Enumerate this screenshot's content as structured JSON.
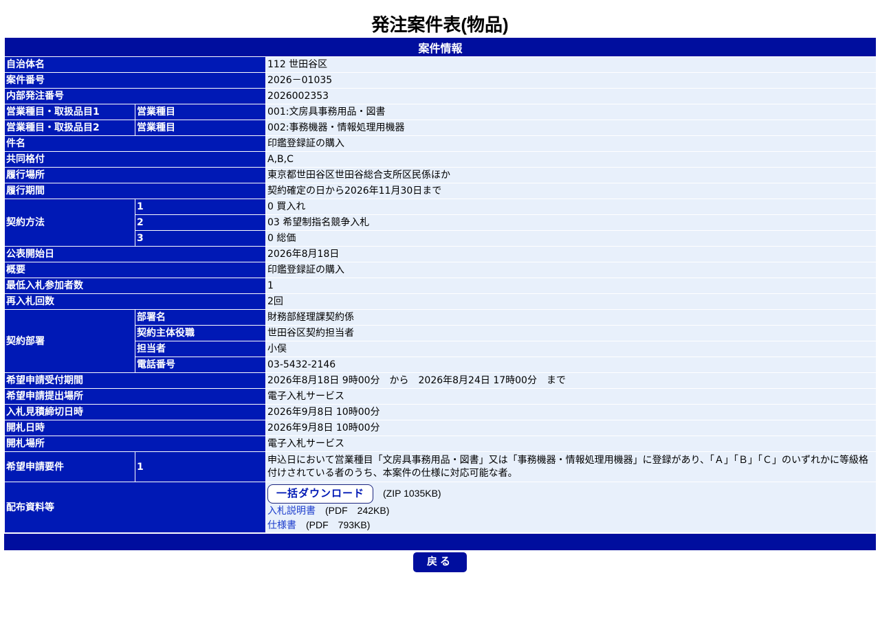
{
  "title": "発注案件表(物品)",
  "section_header": "案件情報",
  "rows": {
    "municipality": {
      "label": "自治体名",
      "value": "112 世田谷区"
    },
    "case_number": {
      "label": "案件番号",
      "value": "2026－01035"
    },
    "internal_number": {
      "label": "内部発注番号",
      "value": "2026002353"
    },
    "business_type1": {
      "label": "営業種目・取扱品目1",
      "sub": "営業種目",
      "value": "001:文房具事務用品・図書"
    },
    "business_type2": {
      "label": "営業種目・取扱品目2",
      "sub": "営業種目",
      "value": "002:事務機器・情報処理用機器"
    },
    "subject": {
      "label": "件名",
      "value": "印鑑登録証の購入"
    },
    "joint_rating": {
      "label": "共同格付",
      "value": "A,B,C"
    },
    "place": {
      "label": "履行場所",
      "value": "東京都世田谷区世田谷総合支所区民係ほか"
    },
    "period": {
      "label": "履行期間",
      "value": "契約確定の日から2026年11月30日まで"
    },
    "contract_method": {
      "label": "契約方法",
      "items": [
        {
          "sub": "1",
          "value": "0 買入れ"
        },
        {
          "sub": "2",
          "value": "03 希望制指名競争入札"
        },
        {
          "sub": "3",
          "value": "0 総価"
        }
      ]
    },
    "publish_date": {
      "label": "公表開始日",
      "value": "2026年8月18日"
    },
    "overview": {
      "label": "概要",
      "value": "印鑑登録証の購入"
    },
    "min_bidders": {
      "label": "最低入札参加者数",
      "value": "1"
    },
    "rebid_count": {
      "label": "再入札回数",
      "value": "2回"
    },
    "department": {
      "label": "契約部署",
      "items": [
        {
          "sub": "部署名",
          "value": "財務部経理課契約係"
        },
        {
          "sub": "契約主体役職",
          "value": "世田谷区契約担当者"
        },
        {
          "sub": "担当者",
          "value": "小俣"
        },
        {
          "sub": "電話番号",
          "value": "03-5432-2146"
        }
      ]
    },
    "application_period": {
      "label": "希望申請受付期間",
      "value": "2026年8月18日 9時00分　から　2026年8月24日 17時00分　まで"
    },
    "application_place": {
      "label": "希望申請提出場所",
      "value": "電子入札サービス"
    },
    "estimate_deadline": {
      "label": "入札見積締切日時",
      "value": "2026年9月8日 10時00分"
    },
    "opening_datetime": {
      "label": "開札日時",
      "value": "2026年9月8日 10時00分"
    },
    "opening_place": {
      "label": "開札場所",
      "value": "電子入札サービス"
    },
    "requirements": {
      "label": "希望申請要件",
      "sub": "1",
      "value": "申込日において営業種目「文房具事務用品・図書」又は「事務機器・情報処理用機器」に登録があり、「Ａ」「Ｂ」「Ｃ」のいずれかに等級格付けされている者のうち、本案件の仕様に対応可能な者。"
    },
    "documents": {
      "label": "配布資料等",
      "bulk_button": "一括ダウンロード",
      "bulk_size": "(ZIP 1035KB)",
      "files": [
        {
          "name": "入札説明書",
          "size": "(PDF　242KB)"
        },
        {
          "name": "仕様書",
          "size": "(PDF　793KB)"
        }
      ]
    }
  },
  "back_button": "戻る"
}
